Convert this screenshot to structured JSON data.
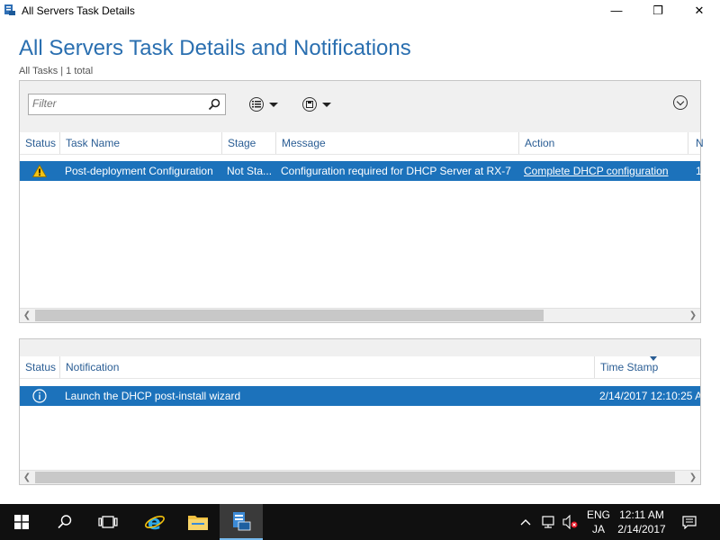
{
  "window": {
    "title": "All Servers Task Details",
    "minimize": "—",
    "maximize": "❐",
    "close": "✕"
  },
  "page": {
    "title": "All Servers Task Details and Notifications",
    "subtitle": "All Tasks | 1 total"
  },
  "tasks_panel": {
    "filter_placeholder": "Filter",
    "columns": [
      "Status",
      "Task Name",
      "Stage",
      "Message",
      "Action",
      "N"
    ],
    "rows": [
      {
        "status_icon": "warning-icon",
        "task_name": "Post-deployment Configuration",
        "stage": "Not Sta...",
        "message": "Configuration required for DHCP Server at RX-7",
        "action": "Complete DHCP configuration",
        "extra": "1"
      }
    ]
  },
  "notifications_panel": {
    "columns": [
      "Status",
      "Notification",
      "Time Stamp"
    ],
    "rows": [
      {
        "status_icon": "info-icon",
        "notification": "Launch the DHCP post-install wizard",
        "time_stamp": "2/14/2017 12:10:25 A"
      }
    ]
  },
  "taskbar": {
    "language_top": "ENG",
    "language_bottom": "JA",
    "time": "12:11 AM",
    "date": "2/14/2017"
  },
  "colors": {
    "accent": "#1c72bb",
    "title_blue": "#2a6fb0",
    "taskbar": "#101010"
  }
}
